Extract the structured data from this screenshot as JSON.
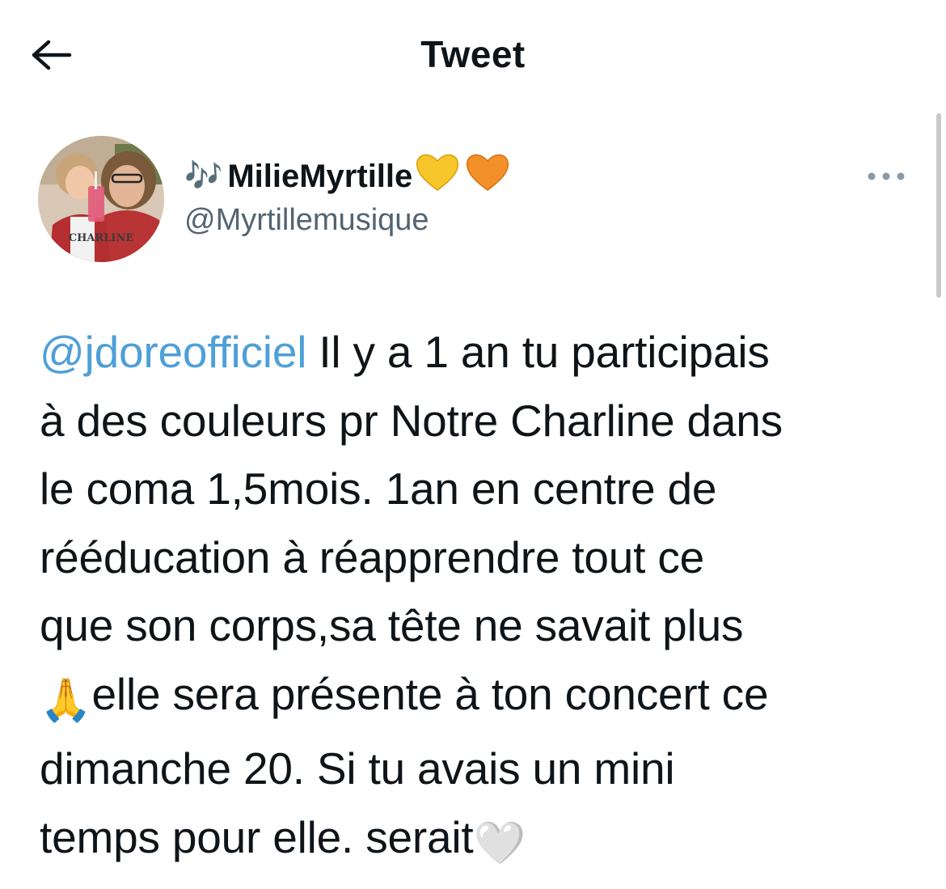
{
  "header": {
    "title": "Tweet",
    "back_icon": "arrow-left-icon"
  },
  "author": {
    "name_prefix_icon": "music-notes-icon",
    "name_prefix": "🎶",
    "display_name": "MilieMyrtille",
    "name_suffix_icons": [
      "yellow-heart-icon",
      "orange-heart-icon"
    ],
    "name_suffix": "💛🧡",
    "handle": "@Myrtillemusique",
    "avatar_caption": "CHARLINE"
  },
  "more_icon": "more-horizontal-icon",
  "tweet": {
    "mention": "@jdoreofficiel",
    "lines": [
      " Il y a 1 an tu participais",
      "à des couleurs pr Notre Charline dans",
      "le coma 1,5mois. 1an en centre de",
      "rééducation à réapprendre tout ce",
      "que son corps,sa tête ne savait plus",
      "elle sera présente à ton concert ce",
      "dimanche 20. Si tu avais un mini",
      "temps pour elle. serait"
    ],
    "emojis": {
      "praying": "🙏",
      "white_heart": "🤍"
    }
  },
  "colors": {
    "mention": "#4f9fd8",
    "handle": "#536471",
    "text": "#0f1419",
    "yellow_heart": "#f7c62a",
    "orange_heart": "#f4902a"
  }
}
